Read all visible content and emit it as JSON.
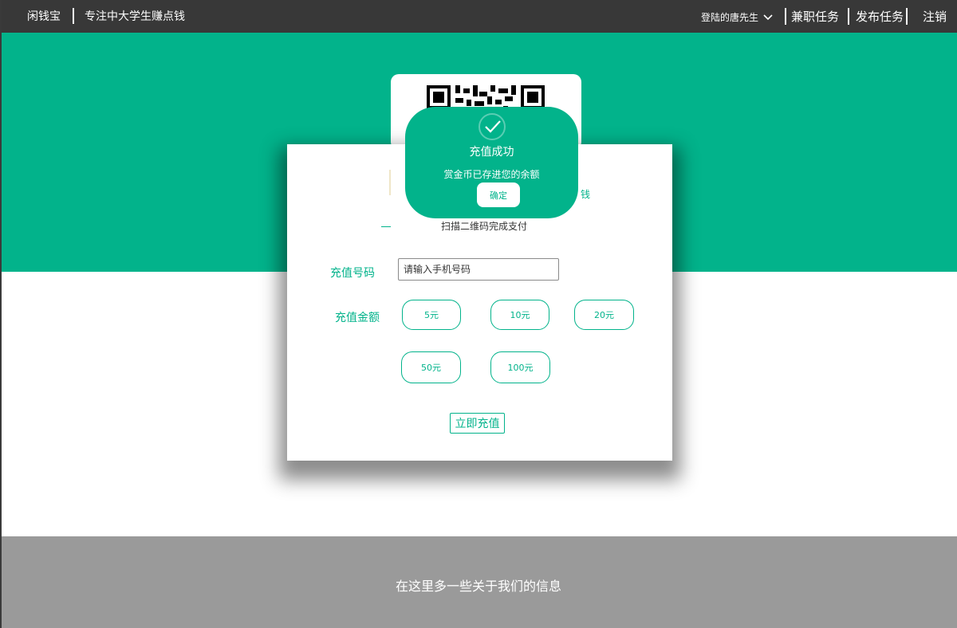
{
  "header": {
    "brand": "闲钱宝",
    "slogan": "专注中大学生赚点钱",
    "user_menu_label": "登陆的唐先生",
    "nav": [
      "兼职任务",
      "发布任务",
      "注销"
    ]
  },
  "recharge": {
    "tab_partial_text": "钱",
    "scan_hint": "扫描二维码完成支付",
    "phone_label": "充值号码",
    "phone_placeholder": "请输入手机号码",
    "amount_label": "充值金额",
    "amounts": [
      "5元",
      "10元",
      "20元",
      "50元",
      "100元"
    ],
    "submit_label": "立即充值"
  },
  "popup": {
    "title": "充值成功",
    "message": "赏金币已存进您的余额",
    "confirm_label": "确定"
  },
  "footer": {
    "text": "在这里多一些关于我们的信息"
  },
  "colors": {
    "accent": "#02b38b",
    "header_bg": "#383838",
    "footer_bg": "#9a9a9a"
  },
  "icons": [
    "chevron-down-icon",
    "checkmark-icon",
    "qr-code"
  ]
}
